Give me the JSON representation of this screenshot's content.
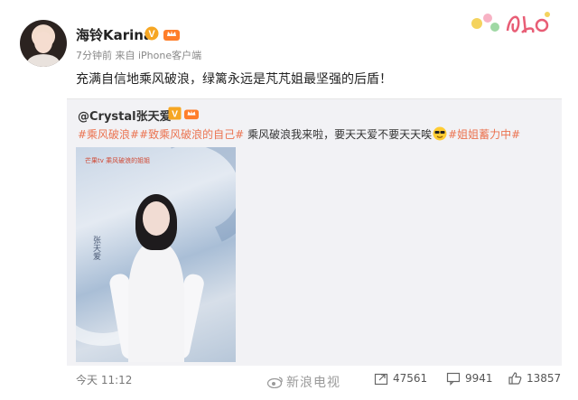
{
  "post": {
    "author": "海铃Karina",
    "meta": "7分钟前 来自 iPhone客户端",
    "text": "充满自信地乘风破浪，绿篱永远是芃芃姐最坚强的后盾！"
  },
  "quoted": {
    "author": "@Crystal张天爱",
    "tag1": "#乘风破浪#",
    "tag2": "#致乘风破浪的自己#",
    "body": " 乘风破浪我来啦，要天天爱不要天天唉",
    "tag3": "#姐姐蓄力中#",
    "photo_logo": "芒果tv 乘风破浪的姐姐",
    "photo_signature": "张天爱"
  },
  "footer": {
    "time": "今天 11:12",
    "watermark": "新浪电视",
    "share_count": "47561",
    "comment_count": "9941",
    "like_count": "13857"
  },
  "colors": {
    "tag": "#eb7350",
    "vip_badge": "#f6a623",
    "quote_bg": "#f2f2f5"
  },
  "icons": [
    "vip-badge-icon",
    "crown-badge-icon",
    "sunglasses-emoji-icon",
    "share-icon",
    "comment-icon",
    "like-icon",
    "weibo-logo-icon"
  ]
}
